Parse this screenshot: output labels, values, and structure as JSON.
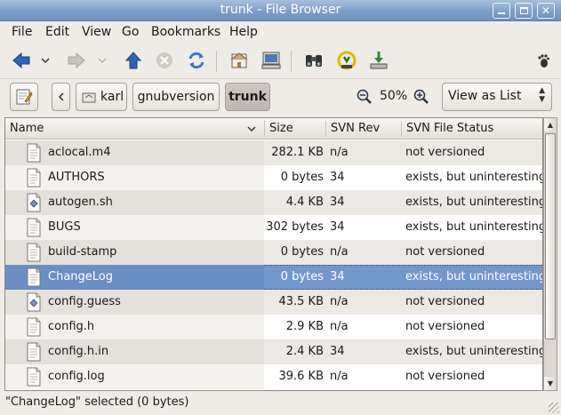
{
  "window": {
    "title": "trunk - File Browser"
  },
  "menu": [
    "File",
    "Edit",
    "View",
    "Go",
    "Bookmarks",
    "Help"
  ],
  "toolbar": {
    "icons": [
      "back-arrow-icon",
      "back-history-icon",
      "forward-arrow-icon",
      "forward-history-icon",
      "up-arrow-icon",
      "stop-icon",
      "reload-icon",
      "home-icon",
      "computer-icon",
      "search-icon",
      "svn-icon",
      "download-icon",
      "foot-icon"
    ]
  },
  "location": {
    "crumbs": [
      "karl",
      "gnubversion",
      "trunk"
    ],
    "zoom": "50%",
    "view_mode": "View as List"
  },
  "columns": [
    "Name",
    "Size",
    "SVN Rev",
    "SVN File Status"
  ],
  "files": [
    {
      "name": "aclocal.m4",
      "size": "282.1 KB",
      "rev": "n/a",
      "status": "not versioned",
      "icon": "text-file-icon"
    },
    {
      "name": "AUTHORS",
      "size": "0 bytes",
      "rev": "34",
      "status": "exists, but uninteresting",
      "icon": "text-file-icon"
    },
    {
      "name": "autogen.sh",
      "size": "4.4 KB",
      "rev": "34",
      "status": "exists, but uninteresting",
      "icon": "script-file-icon"
    },
    {
      "name": "BUGS",
      "size": "302 bytes",
      "rev": "34",
      "status": "exists, but uninteresting",
      "icon": "text-file-icon"
    },
    {
      "name": "build-stamp",
      "size": "0 bytes",
      "rev": "n/a",
      "status": "not versioned",
      "icon": "text-file-icon"
    },
    {
      "name": "ChangeLog",
      "size": "0 bytes",
      "rev": "34",
      "status": "exists, but uninteresting",
      "icon": "text-file-icon"
    },
    {
      "name": "config.guess",
      "size": "43.5 KB",
      "rev": "n/a",
      "status": "not versioned",
      "icon": "script-file-icon"
    },
    {
      "name": "config.h",
      "size": "2.9 KB",
      "rev": "n/a",
      "status": "not versioned",
      "icon": "text-file-icon"
    },
    {
      "name": "config.h.in",
      "size": "2.4 KB",
      "rev": "34",
      "status": "exists, but uninteresting",
      "icon": "text-file-icon"
    },
    {
      "name": "config.log",
      "size": "39.6 KB",
      "rev": "n/a",
      "status": "not versioned",
      "icon": "text-file-icon"
    }
  ],
  "selected_index": 5,
  "status": "\"ChangeLog\" selected (0 bytes)",
  "colors": {
    "selection": "#7397cb",
    "titlebar": "#7e9dc9",
    "arrow_blue": "#2f63b8"
  }
}
